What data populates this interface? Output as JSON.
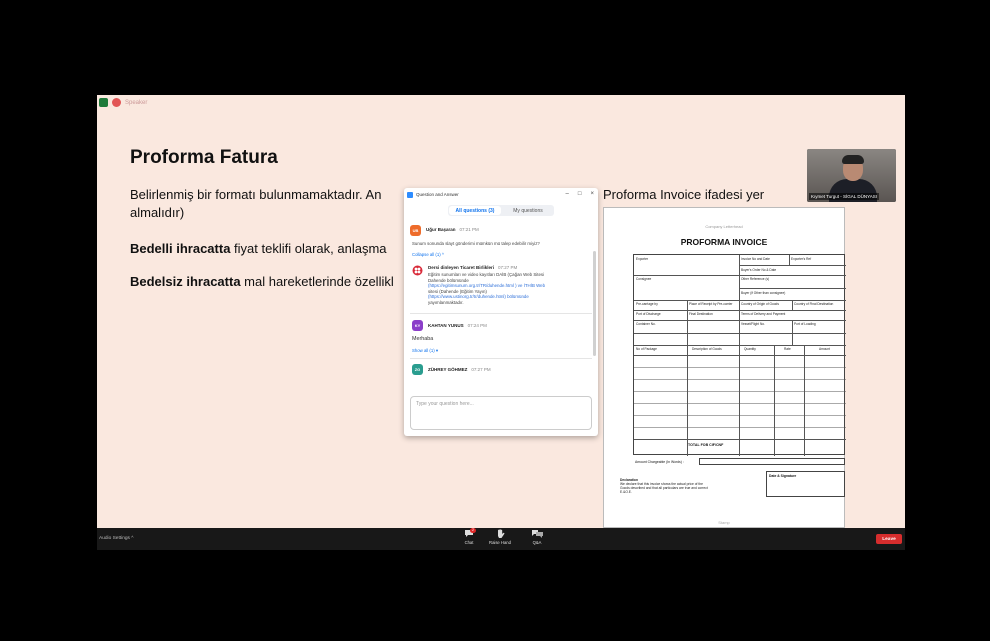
{
  "share": {
    "label": "Speaker"
  },
  "slide": {
    "title": "Proforma Fatura",
    "p1_line1": "Belirlenmiş bir formatı bulunmamaktadır. An",
    "p1_line1_tail": "Proforma Invoice ifadesi yer",
    "p1_line2": "almalıdır)",
    "p2_bold": "Bedelli ihracatta",
    "p2_rest": " fiyat teklifi olarak, anlaşma ",
    "p3_bold": "Bedelsiz ihracatta",
    "p3_rest": " mal hareketlerinde özellikl"
  },
  "video": {
    "name": "Kıymet Turgut - SİGAL DÜNYASI"
  },
  "qa_window": {
    "title": "Question and Answer",
    "ctrl_min": "–",
    "ctrl_max": "□",
    "ctrl_close": "×",
    "tabs": [
      "All questions (3)",
      "My questions"
    ],
    "q1": {
      "initials": "UB",
      "name": "Uğur Başaran",
      "time": "07:21 PM",
      "text": "Sunum sonunda slayt gönderimi mümkün mü talep edebilir miyiz?",
      "collapse": "Collapse all (1) ^"
    },
    "a1": {
      "name": "Dersi dinleyen Ticaret Birlikleri",
      "time": "07:27 PM",
      "l1": "Eğitim sunumları ve video kayıtları DAİB (Çağan Web Sitesi",
      "l2": "Dahende bölümünde",
      "l3": "(https://egitimsunum.org.tr/TR/duhende.html ) ve İTHİB Web",
      "l4": "sitesi (Dahende (Eğitim Yayın)",
      "l5": "(https://www.ustinorg.tr/tr/duhende.html) bölümünde",
      "l6": "yayımlanmaktadır."
    },
    "q2": {
      "initials": "KY",
      "name": "KAHTAN YUNUS",
      "time": "07:24 PM",
      "text": "Merhaba",
      "more": "Show all (1) ▾"
    },
    "q3": {
      "initials": "ZG",
      "name": "ZÜHREY GÖHMEZ",
      "time": "07:27 PM"
    },
    "input_placeholder": "Type your question here..."
  },
  "invoice": {
    "subtitle": "Company Letterhead",
    "title": "PROFORMA INVOICE",
    "cells": {
      "exporter": "Exporter",
      "inv_no": "Invoice No and Date",
      "exp_ref": "Exporter's Ref",
      "buyer_order": "Buyer's Order No & Date",
      "consignee": "Consignee",
      "other_ref": "Other Reference (s)",
      "buyer": "Buyer (if Other than consignee)",
      "precarriage": "Pre-carriage by",
      "place_receipt": "Place of Receipt by Pre-carrier",
      "country_origin": "Country of Origin of Goods",
      "country_dest": "Country of Final Destination",
      "port_discharge": "Port of Discharge",
      "final_dest": "Final Destination",
      "terms": "Terms of Delivery and Payment",
      "container": "Container No.",
      "vessel": "Vessel/Flight No.",
      "port_loading": "Port of Loading",
      "packages": "No of Package",
      "description": "Description of Goods",
      "quantity": "Quantity",
      "rate": "Rate",
      "amount": "Amount"
    },
    "total": "TOTAL FOB CIF/CNF",
    "amount_words": "Amount Chargeable (In Words) :",
    "signature": "Date & Signature",
    "declaration_title": "Declaration",
    "declaration_l1": "We declare that this invoice shows the actual price of the",
    "declaration_l2": "Goods described and that all particulars are true and correct",
    "declaration_l3": "E.&O.E.",
    "footer": "Stamp"
  },
  "toolbar": {
    "audio": "Audio Settings ^",
    "chat_label": "Chat",
    "chat_badge": "2",
    "raise_label": "Raise Hand",
    "qa_label": "Q&A",
    "leave": "Leave"
  }
}
